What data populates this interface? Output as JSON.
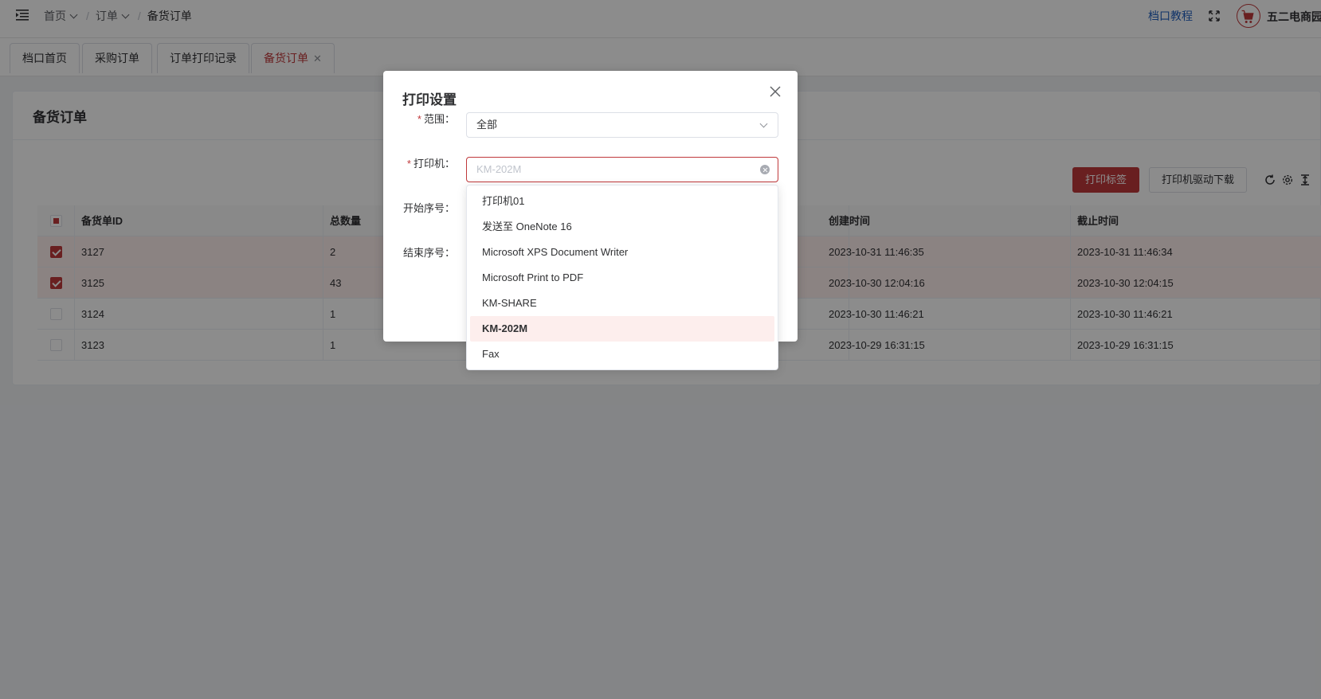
{
  "topbar": {
    "breadcrumb": {
      "home": "首页",
      "orders": "订单",
      "current": "备货订单"
    },
    "help_link": "档口教程",
    "shop_name": "五二电商园"
  },
  "tabs": [
    {
      "label": "档口首页"
    },
    {
      "label": "采购订单"
    },
    {
      "label": "订单打印记录"
    },
    {
      "label": "备货订单",
      "active": true
    }
  ],
  "page": {
    "title": "备货订单",
    "print_label_button": "打印标签",
    "driver_download_button": "打印机驱动下载"
  },
  "table": {
    "columns": [
      "备货单ID",
      "总数量",
      "创建时间",
      "截止时间"
    ],
    "rows": [
      {
        "id": "3127",
        "qty": "2",
        "created": "2023-10-31 11:46:35",
        "deadline": "2023-10-31 11:46:34",
        "checked": true
      },
      {
        "id": "3125",
        "qty": "43",
        "created": "2023-10-30 12:04:16",
        "deadline": "2023-10-30 12:04:15",
        "checked": true
      },
      {
        "id": "3124",
        "qty": "1",
        "created": "2023-10-30 11:46:21",
        "deadline": "2023-10-30 11:46:21",
        "checked": false
      },
      {
        "id": "3123",
        "qty": "1",
        "created": "2023-10-29 16:31:15",
        "deadline": "2023-10-29 16:31:15",
        "checked": false
      }
    ]
  },
  "dialog": {
    "title": "打印设置",
    "range_label": "范围：",
    "range_value": "全部",
    "printer_label": "打印机：",
    "printer_placeholder": "KM-202M",
    "start_label": "开始序号：",
    "end_label": "结束序号："
  },
  "dropdown": {
    "options": [
      "打印机01",
      "发送至 OneNote 16",
      "Microsoft XPS Document Writer",
      "Microsoft Print to PDF",
      "KM-SHARE",
      "KM-202M",
      "Fax"
    ],
    "hovered_index": 5
  },
  "colors": {
    "accent": "#c0393b",
    "link": "#1f5fbf",
    "selected_row": "#fdeeed"
  }
}
